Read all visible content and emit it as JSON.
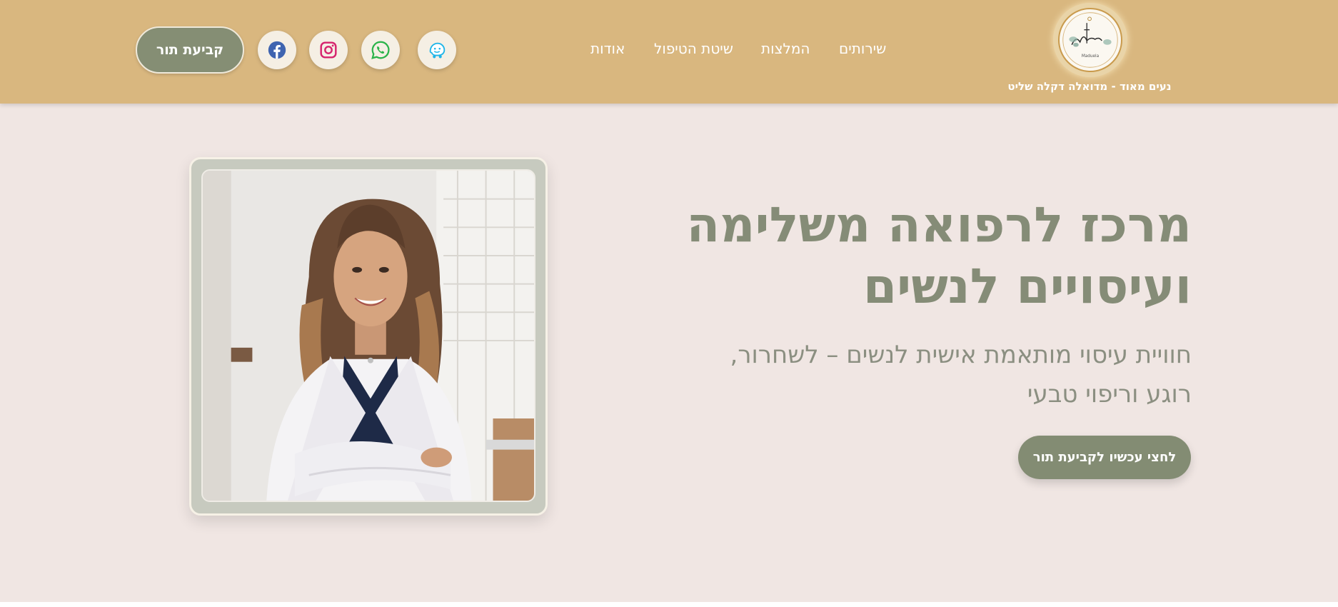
{
  "header": {
    "logo": {
      "script_text": "Maduela",
      "caption": "נעים מאוד - מדואלה דקלה שליט"
    },
    "nav": [
      {
        "id": "services",
        "label": "שירותים"
      },
      {
        "id": "recommendations",
        "label": "המלצות"
      },
      {
        "id": "method",
        "label": "שיטת הטיפול"
      },
      {
        "id": "about",
        "label": "אודות"
      }
    ],
    "social": [
      {
        "id": "waze",
        "icon": "waze-icon",
        "color": "#33ccff"
      },
      {
        "id": "whatsapp",
        "icon": "whatsapp-icon",
        "color": "#25d366"
      },
      {
        "id": "instagram",
        "icon": "instagram-icon",
        "color": "#e1306c"
      },
      {
        "id": "facebook",
        "icon": "facebook-icon",
        "color": "#3b5998"
      }
    ],
    "cta_label": "קביעת תור"
  },
  "hero": {
    "title": "מרכז לרפואה משלימה ועיסויים לנשים",
    "subtitle": "חוויית עיסוי מותאמת אישית לנשים – לשחרור, רוגע וריפוי טבעי",
    "cta_label": "לחצי עכשיו לקביעת תור",
    "image": "portrait-photo"
  },
  "colors": {
    "header_bg": "#d9b77f",
    "hero_bg": "#f0e6e3",
    "accent_green": "#858e74",
    "title_color": "#858c77"
  }
}
